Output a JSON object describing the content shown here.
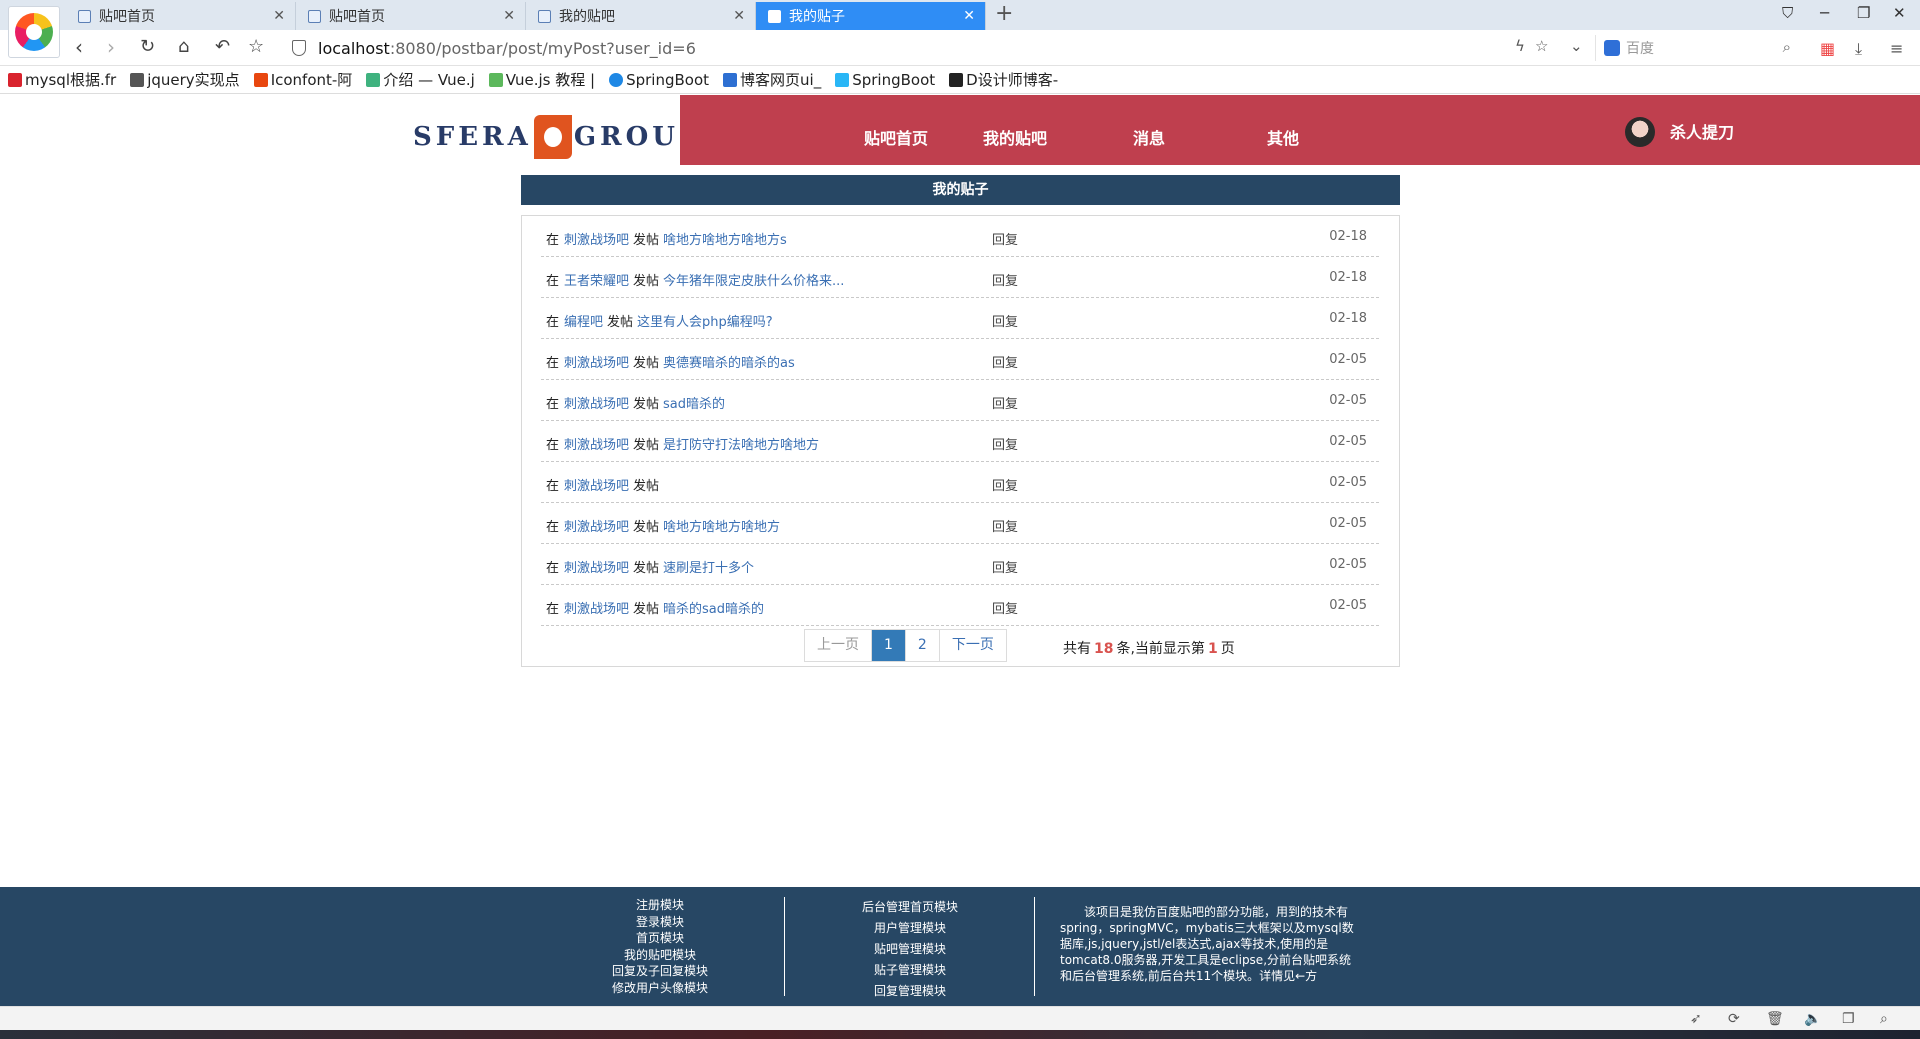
{
  "browser": {
    "tabs": [
      {
        "title": "贴吧首页",
        "active": false
      },
      {
        "title": "贴吧首页",
        "active": false
      },
      {
        "title": "我的贴吧",
        "active": false
      },
      {
        "title": "我的贴子",
        "active": true
      }
    ],
    "url_host": "localhost",
    "url_path": ":8080/postbar/post/myPost?user_id=6",
    "search_placeholder": "百度",
    "bookmarks": [
      {
        "label": "mysql根据.fr",
        "color": "#d9232e"
      },
      {
        "label": "jquery实现点",
        "color": "#555555"
      },
      {
        "label": "Iconfont-阿",
        "color": "#e8470f"
      },
      {
        "label": "介绍 — Vue.j",
        "color": "#3fb27f"
      },
      {
        "label": "Vue.js 教程 |",
        "color": "#5cb85c"
      },
      {
        "label": "SpringBoot",
        "color": "#1e88e5"
      },
      {
        "label": "博客网页ui_",
        "color": "#2d6fd2"
      },
      {
        "label": "SpringBoot",
        "color": "#29b6f6"
      },
      {
        "label": "D设计师博客-",
        "color": "#222222"
      }
    ]
  },
  "header": {
    "brand_left": "SFERA",
    "brand_right": "GROUP",
    "nav": [
      "贴吧首页",
      "我的贴吧",
      "消息",
      "其他"
    ],
    "user_name": "杀人提刀"
  },
  "main": {
    "section_title": "我的贴子",
    "in_label": "在",
    "post_label": "发帖",
    "reply_label": "回复",
    "posts": [
      {
        "bar": "刺激战场吧",
        "title": "啥地方啥地方啥地方s",
        "date": "02-18"
      },
      {
        "bar": "王者荣耀吧",
        "title": "今年猪年限定皮肤什么价格来...",
        "date": "02-18"
      },
      {
        "bar": "编程吧",
        "title": "这里有人会php编程吗?",
        "date": "02-18"
      },
      {
        "bar": "刺激战场吧",
        "title": "奥德赛暗杀的暗杀的as",
        "date": "02-05"
      },
      {
        "bar": "刺激战场吧",
        "title": "sad暗杀的",
        "date": "02-05"
      },
      {
        "bar": "刺激战场吧",
        "title": "是打防守打法啥地方啥地方",
        "date": "02-05"
      },
      {
        "bar": "刺激战场吧",
        "title": "",
        "date": "02-05"
      },
      {
        "bar": "刺激战场吧",
        "title": "啥地方啥地方啥地方",
        "date": "02-05"
      },
      {
        "bar": "刺激战场吧",
        "title": "速刷是打十多个",
        "date": "02-05"
      },
      {
        "bar": "刺激战场吧",
        "title": "暗杀的sad暗杀的",
        "date": "02-05"
      }
    ],
    "pager": {
      "prev": "上一页",
      "pages": [
        "1",
        "2"
      ],
      "current": "1",
      "next": "下一页",
      "info_prefix": "共有",
      "total": "18",
      "info_middle": "条,当前显示第",
      "current_page": "1",
      "info_suffix": "页"
    }
  },
  "footer": {
    "col1": [
      "注册模块",
      "登录模块",
      "首页模块",
      "我的贴吧模块",
      "回复及子回复模块",
      "修改用户头像模块"
    ],
    "col2": [
      "后台管理首页模块",
      "用户管理模块",
      "贴吧管理模块",
      "贴子管理模块",
      "回复管理模块"
    ],
    "description": "该项目是我仿百度贴吧的部分功能，用到的技术有spring，springMVC，mybatis三大框架以及mysql数据库,js,jquery,jstl/el表达式,ajax等技术,使用的是tomcat8.0服务器,开发工具是eclipse,分前台贴吧系统和后台管理系统,前后台共11个模块。详情见←方"
  }
}
